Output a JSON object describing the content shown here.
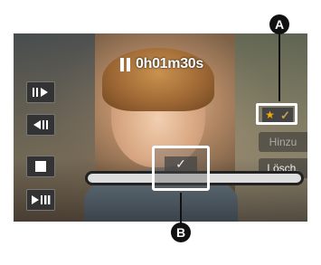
{
  "player": {
    "time": "0h01m30s",
    "state": "paused",
    "position_fraction": 0.4
  },
  "left_controls": [
    {
      "name": "step-forward-button",
      "icon": "frame-advance-icon"
    },
    {
      "name": "step-back-button",
      "icon": "frame-reverse-icon"
    },
    {
      "name": "stop-button",
      "icon": "stop-icon"
    },
    {
      "name": "play-pause-button",
      "icon": "play-pause-icon"
    }
  ],
  "right_buttons": {
    "add_label": "Hinzu",
    "delete_label": "Lösch."
  },
  "callouts": {
    "a": "A",
    "b": "B"
  },
  "colors": {
    "overlay_button": "#333333",
    "highlight_border": "#ffffff",
    "star": "#f2a900",
    "check": "#c8a24a"
  }
}
